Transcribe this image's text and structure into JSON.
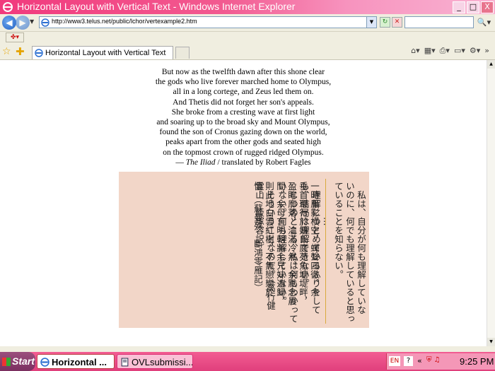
{
  "window": {
    "title": "Horizontal Layout with Vertical Text - Windows Internet Explorer",
    "minimize": "_",
    "maximize": "□",
    "close": "X"
  },
  "address_bar": {
    "url": "http://www3.telus.net/public/lchor/vertexample2.htm",
    "search_placeholder": ""
  },
  "tab": {
    "label": "Horizontal Layout with Vertical Text"
  },
  "poem": {
    "lines": [
      "But now as the twelfth dawn after this shone clear",
      "the gods who live forever marched home to Olympus,",
      "all in a long cortege, and Zeus led them on.",
      "And Thetis did not forget her son's appeals.",
      "She broke from a cresting wave at first light",
      "and soaring up to the broad sky and Mount Olympus,",
      "found the son of Cronus gazing down on the world,",
      "peaks apart from the other gods and seated high",
      "on the topmost crown of rugged ridged Olympus."
    ],
    "attribution_dash": "— ",
    "attribution_work": "The Iliad",
    "attribution_rest": " / translated by Robert Fagles"
  },
  "vertical_text": {
    "japanese_columns": [
      "　私は、自分が何も理解していな",
      "いのに、何でも理解していると思っ",
      "ていることを知らない。",
      "　　　　…",
      "　理解につとめているふりをして",
      "も、結局は理解できない。",
      "　じつのところ、私は何もわかって",
      "いない。何も理解していない。",
      "　そういうことなのだ。（高行健",
      "霊山　飯塚容訳）"
    ],
    "chinese_columns": [
      "一時雁影横空，蟬聲四徹。余",
      "垂首環行於姨氏庭苑魚塘堤畔，",
      "盈眸廓落，淪滿冷然。余默念晨",
      "間，余母言明朝將余兄妹遄歸，",
      "則此地白雲紅樹，不無戀戀於",
      "懷。（蘇曼殊　斷鴻零雁記）"
    ]
  },
  "taskbar": {
    "start": "Start",
    "active_task": "Horizontal ...",
    "other_task": "OVLsubmissi...",
    "language": "EN",
    "help": "?",
    "chevron": "«",
    "clock": "9:25 PM"
  }
}
